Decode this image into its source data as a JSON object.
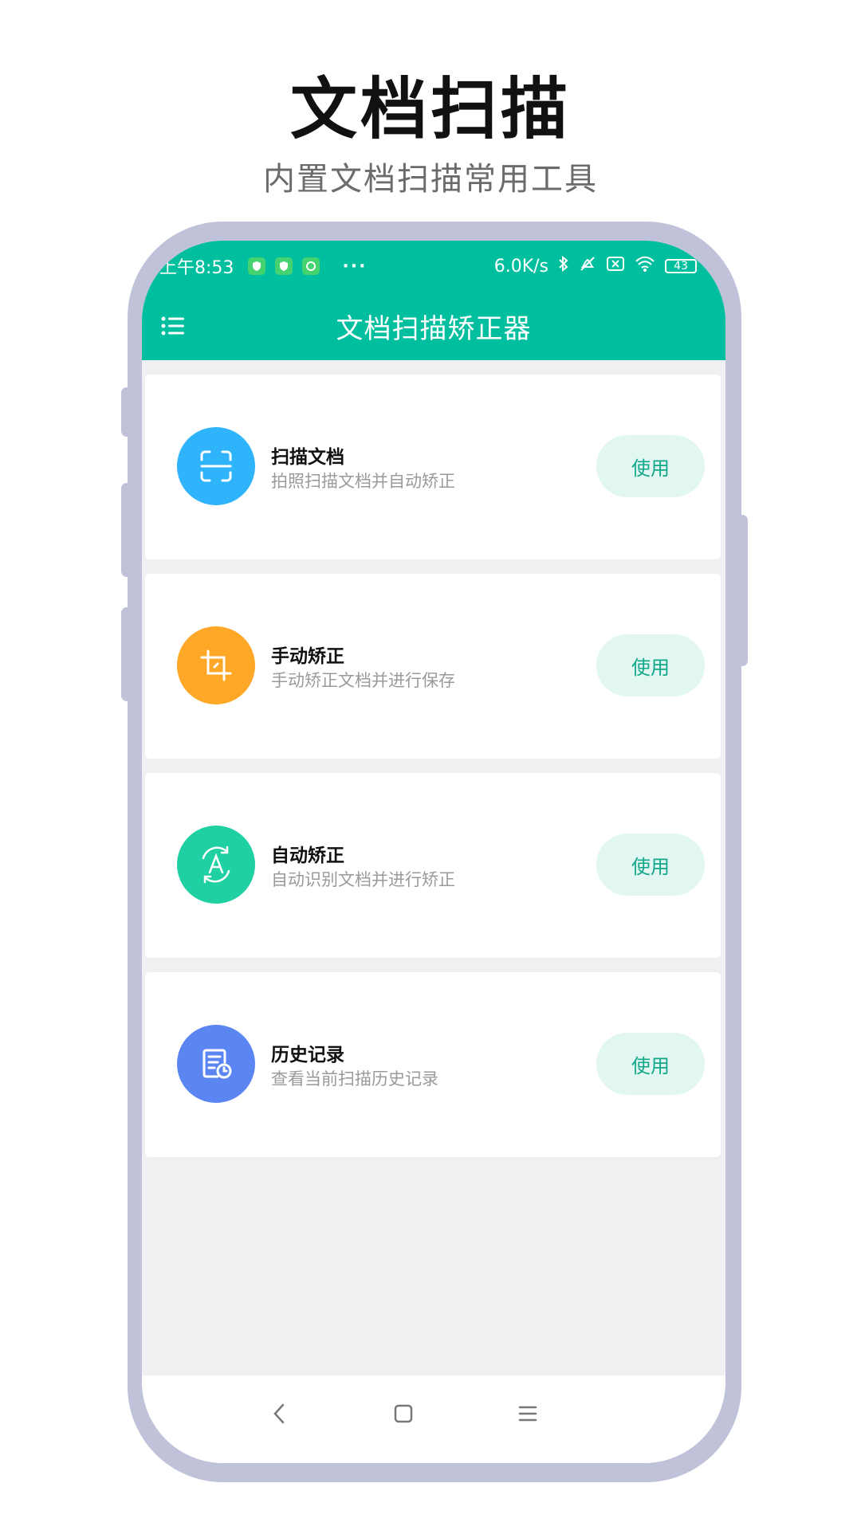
{
  "promo": {
    "title": "文档扫描",
    "subtitle": "内置文档扫描常用工具"
  },
  "status_bar": {
    "time": "上午8:53",
    "network_speed": "6.0K/s",
    "battery": "43",
    "icons": [
      "shield-icon",
      "shield-icon",
      "app-badge-icon",
      "more-dots-icon",
      "bluetooth-icon",
      "mute-icon",
      "sim-icon",
      "wifi-icon",
      "battery-icon",
      "charging-icon"
    ]
  },
  "app_bar": {
    "title": "文档扫描矫正器",
    "menu_icon": "list-menu-icon"
  },
  "features": [
    {
      "title": "扫描文档",
      "desc": "拍照扫描文档并自动矫正",
      "button": "使用",
      "icon": "scan-frame-icon",
      "color": "#2fb3fa"
    },
    {
      "title": "手动矫正",
      "desc": "手动矫正文档并进行保存",
      "button": "使用",
      "icon": "crop-icon",
      "color": "#ffa726"
    },
    {
      "title": "自动矫正",
      "desc": "自动识别文档并进行矫正",
      "button": "使用",
      "icon": "auto-rotate-icon",
      "color": "#1fd0a3"
    },
    {
      "title": "历史记录",
      "desc": "查看当前扫描历史记录",
      "button": "使用",
      "icon": "history-doc-icon",
      "color": "#5b86f2"
    }
  ],
  "nav_bar": {
    "icons": [
      "back-icon",
      "home-icon",
      "recents-icon"
    ]
  },
  "colors": {
    "accent": "#00bf9e",
    "frame": "#bfc2d8",
    "button_bg": "#e3f7f2",
    "button_text": "#10a789"
  }
}
